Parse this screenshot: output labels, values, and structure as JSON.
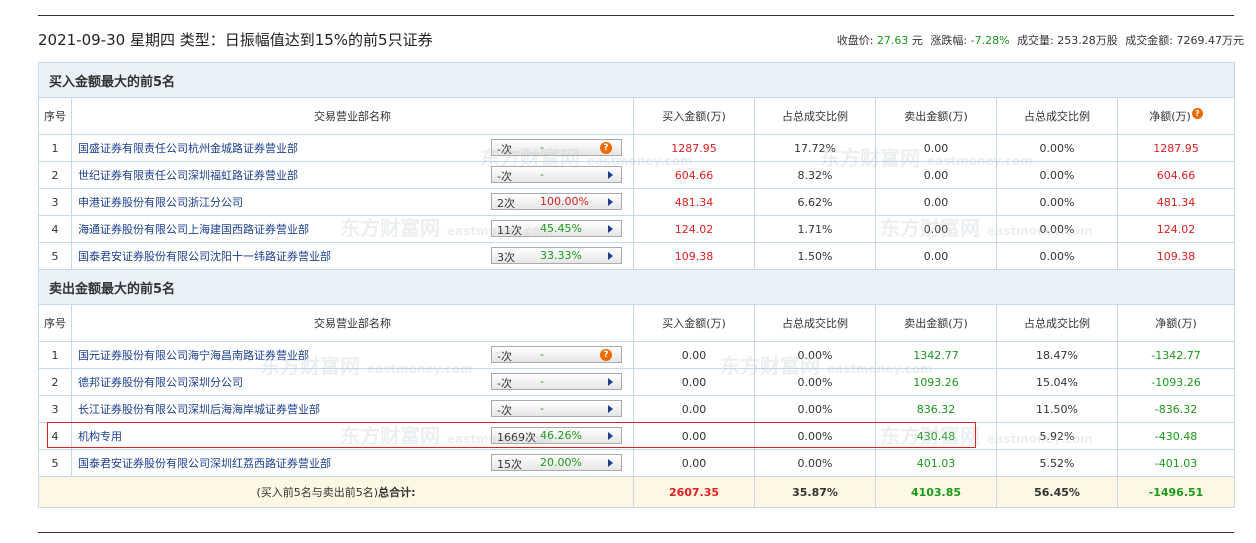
{
  "header": {
    "title": "2021-09-30 星期四 类型：日振幅值达到15%的前5只证券",
    "close_label": "收盘价:",
    "close_value": "27.63",
    "close_unit": "元",
    "change_label": "涨跌幅:",
    "change_value": "-7.28%",
    "volume_label": "成交量:",
    "volume_value": "253.28万股",
    "turnover_label": "成交金额:",
    "turnover_value": "7269.47万元"
  },
  "watermark": {
    "line1": "东方财富网",
    "line2": "eastmoney.com"
  },
  "columns": [
    "序号",
    "交易营业部名称",
    "买入金额(万)",
    "占总成交比例",
    "卖出金额(万)",
    "占总成交比例",
    "净额(万)"
  ],
  "buy_section": {
    "title": "买入金额最大的前5名",
    "rows": [
      {
        "no": "1",
        "name": "国盛证券有限责任公司杭州金城路证券营业部",
        "count": "-次",
        "pct": "-",
        "buy": "1287.95",
        "buy_ratio": "17.72%",
        "sell": "0.00",
        "sell_ratio": "0.00%",
        "net": "1287.95"
      },
      {
        "no": "2",
        "name": "世纪证券有限责任公司深圳福虹路证券营业部",
        "count": "-次",
        "pct": "-",
        "buy": "604.66",
        "buy_ratio": "8.32%",
        "sell": "0.00",
        "sell_ratio": "0.00%",
        "net": "604.66"
      },
      {
        "no": "3",
        "name": "申港证券股份有限公司浙江分公司",
        "count": "2次",
        "pct": "100.00%",
        "buy": "481.34",
        "buy_ratio": "6.62%",
        "sell": "0.00",
        "sell_ratio": "0.00%",
        "net": "481.34"
      },
      {
        "no": "4",
        "name": "海通证券股份有限公司上海建国西路证券营业部",
        "count": "11次",
        "pct": "45.45%",
        "buy": "124.02",
        "buy_ratio": "1.71%",
        "sell": "0.00",
        "sell_ratio": "0.00%",
        "net": "124.02"
      },
      {
        "no": "5",
        "name": "国泰君安证券股份有限公司沈阳十一纬路证券营业部",
        "count": "3次",
        "pct": "33.33%",
        "buy": "109.38",
        "buy_ratio": "1.50%",
        "sell": "0.00",
        "sell_ratio": "0.00%",
        "net": "109.38"
      }
    ]
  },
  "sell_section": {
    "title": "卖出金额最大的前5名",
    "rows": [
      {
        "no": "1",
        "name": "国元证券股份有限公司海宁海昌南路证券营业部",
        "count": "-次",
        "pct": "-",
        "buy": "0.00",
        "buy_ratio": "0.00%",
        "sell": "1342.77",
        "sell_ratio": "18.47%",
        "net": "-1342.77"
      },
      {
        "no": "2",
        "name": "德邦证券股份有限公司深圳分公司",
        "count": "-次",
        "pct": "-",
        "buy": "0.00",
        "buy_ratio": "0.00%",
        "sell": "1093.26",
        "sell_ratio": "15.04%",
        "net": "-1093.26"
      },
      {
        "no": "3",
        "name": "长江证券股份有限公司深圳后海海岸城证券营业部",
        "count": "-次",
        "pct": "-",
        "buy": "0.00",
        "buy_ratio": "0.00%",
        "sell": "836.32",
        "sell_ratio": "11.50%",
        "net": "-836.32"
      },
      {
        "no": "4",
        "name": "机构专用",
        "count": "1669次",
        "pct": "46.26%",
        "buy": "0.00",
        "buy_ratio": "0.00%",
        "sell": "430.48",
        "sell_ratio": "5.92%",
        "net": "-430.48"
      },
      {
        "no": "5",
        "name": "国泰君安证券股份有限公司深圳红荔西路证券营业部",
        "count": "15次",
        "pct": "20.00%",
        "buy": "0.00",
        "buy_ratio": "0.00%",
        "sell": "401.03",
        "sell_ratio": "5.52%",
        "net": "-401.03"
      }
    ]
  },
  "total": {
    "label_prefix": "(买入前5名与卖出前5名)",
    "label_main": "总合计:",
    "buy": "2607.35",
    "buy_ratio": "35.87%",
    "sell": "4103.85",
    "sell_ratio": "56.45%",
    "net": "-1496.51"
  },
  "colors": {
    "up": "#e02020",
    "down": "#1a9a1a",
    "link": "#1b3f8f",
    "border": "#c8d8e8",
    "section_bg": "#eaf1f8",
    "total_bg": "#fdf7e3",
    "highlight": "#d22222"
  }
}
